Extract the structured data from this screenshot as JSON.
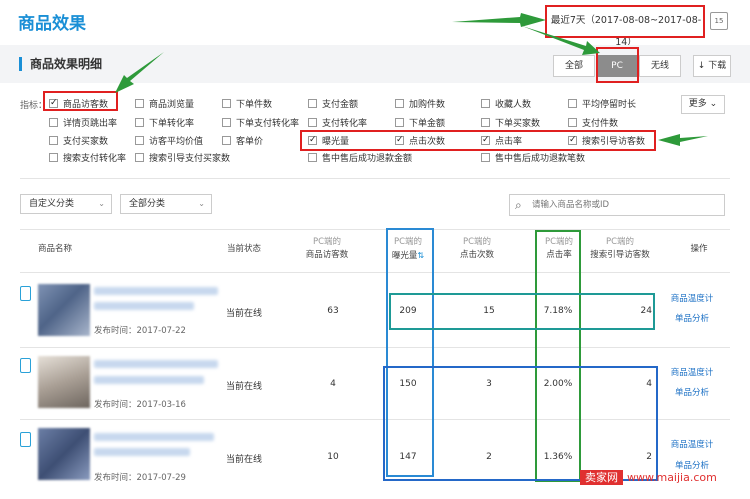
{
  "header": {
    "title": "商品效果",
    "date_range": "最近7天（2017-08-08~2017-08-14）",
    "calendar_label": "15"
  },
  "section": {
    "title": "商品效果明细"
  },
  "terminal": {
    "options": [
      "全部",
      "PC",
      "无线"
    ],
    "selected": "PC"
  },
  "download_label": "下载",
  "metrics": {
    "label": "指标：",
    "more_label": "更多",
    "items": [
      {
        "label": "商品访客数",
        "checked": true
      },
      {
        "label": "商品浏览量",
        "checked": false
      },
      {
        "label": "下单件数",
        "checked": false
      },
      {
        "label": "支付金额",
        "checked": false
      },
      {
        "label": "加购件数",
        "checked": false
      },
      {
        "label": "收藏人数",
        "checked": false
      },
      {
        "label": "平均停留时长",
        "checked": false
      },
      {
        "label": "详情页跳出率",
        "checked": false
      },
      {
        "label": "下单转化率",
        "checked": false
      },
      {
        "label": "下单支付转化率",
        "checked": false
      },
      {
        "label": "支付转化率",
        "checked": false
      },
      {
        "label": "下单金额",
        "checked": false
      },
      {
        "label": "下单买家数",
        "checked": false
      },
      {
        "label": "支付件数",
        "checked": false
      },
      {
        "label": "支付买家数",
        "checked": false
      },
      {
        "label": "访客平均价值",
        "checked": false
      },
      {
        "label": "客单价",
        "checked": false
      },
      {
        "label": "曝光量",
        "checked": true
      },
      {
        "label": "点击次数",
        "checked": true
      },
      {
        "label": "点击率",
        "checked": true
      },
      {
        "label": "搜索引导访客数",
        "checked": true
      },
      {
        "label": "搜索支付转化率",
        "checked": false
      },
      {
        "label": "搜索引导支付买家数",
        "checked": false
      },
      {
        "label": "售中售后成功退款金额",
        "checked": false
      },
      {
        "label": "售中售后成功退款笔数",
        "checked": false
      }
    ]
  },
  "filters": {
    "category_custom": "自定义分类",
    "category_all": "全部分类",
    "search_placeholder": "请输入商品名称或ID"
  },
  "table": {
    "headers": {
      "name": "商品名称",
      "status": "当前状态",
      "visitors": {
        "prefix": "PC端的",
        "label": "商品访客数"
      },
      "exposure": {
        "prefix": "PC端的",
        "label": "曝光量"
      },
      "clicks": {
        "prefix": "PC端的",
        "label": "点击次数"
      },
      "ctr": {
        "prefix": "PC端的",
        "label": "点击率"
      },
      "search": {
        "prefix": "PC端的",
        "label": "搜索引导访客数"
      },
      "ops": "操作"
    },
    "rows": [
      {
        "pub": "发布时间：2017-07-22",
        "status": "当前在线",
        "visitors": "63",
        "exposure": "209",
        "clicks": "15",
        "ctr": "7.18%",
        "search": "24",
        "op1": "商品温度计",
        "op2": "单品分析"
      },
      {
        "pub": "发布时间：2017-03-16",
        "status": "当前在线",
        "visitors": "4",
        "exposure": "150",
        "clicks": "3",
        "ctr": "2.00%",
        "search": "4",
        "op1": "商品温度计",
        "op2": "单品分析"
      },
      {
        "pub": "发布时间：2017-07-29",
        "status": "当前在线",
        "visitors": "10",
        "exposure": "147",
        "clicks": "2",
        "ctr": "1.36%",
        "search": "2",
        "op1": "商品温度计",
        "op2": "单品分析"
      }
    ]
  },
  "watermark": {
    "left": "卖家网",
    "right": "www.maijia.com"
  },
  "colors": {
    "brand": "#1a8fd6",
    "annotation_red": "#e02020",
    "annotation_green": "#2e9a3a",
    "annotation_blue": "#2468c8",
    "annotation_teal": "#1e9a96"
  }
}
